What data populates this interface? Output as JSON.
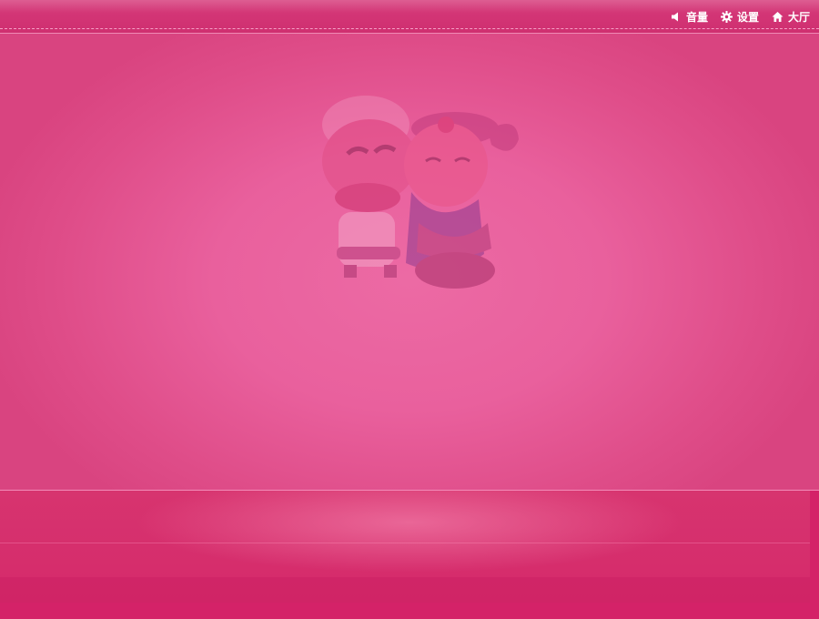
{
  "menu": {
    "volume_label": "音量",
    "settings_label": "设置",
    "lobby_label": "大厅"
  },
  "icons": {
    "volume": "speaker-icon",
    "settings": "gear-icon",
    "lobby": "house-icon"
  },
  "colors": {
    "table": "#e9609d",
    "top_bar": "#d63a7a",
    "bottom_panel": "#d52a6b",
    "text": "#ffffff"
  }
}
